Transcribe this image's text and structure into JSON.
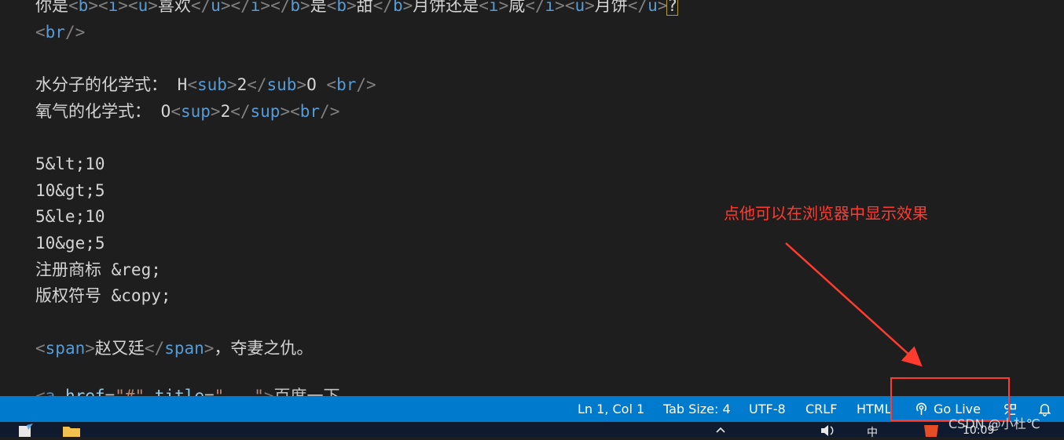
{
  "editor": {
    "line1": {
      "t1": "你是",
      "t2": "喜欢",
      "t3": "是",
      "t4": "甜",
      "t5": "月饼还是",
      "t6": "咸",
      "t7": "月饼",
      "t8": "?",
      "tag_b": "b",
      "tag_i": "i",
      "tag_u": "u"
    },
    "line2": {
      "tag": "br"
    },
    "line3": {
      "label": "水分子的化学式： ",
      "h": "H",
      "tag": "sub",
      "num": "2",
      "o": "O ",
      "br": "br"
    },
    "line4": {
      "label": "氧气的化学式： ",
      "o": "O",
      "tag": "sup",
      "num": "2",
      "br": "br"
    },
    "entities": [
      "5&lt;10",
      "10&gt;5",
      "5&le;10",
      "10&ge;5",
      "注册商标 &reg;",
      "版权符号 &copy;"
    ],
    "span_line": {
      "tag": "span",
      "text": "赵又廷",
      "tail": "，夺妻之仇。"
    },
    "partial_line": {
      "at1": "href",
      "s1": "\"#\"",
      "at2": "title",
      "s2": "\"...\"",
      "t": "百度一下"
    }
  },
  "annotation": {
    "text": "点他可以在浏览器中显示效果",
    "color": "#ff3b30"
  },
  "statusbar": {
    "position": "Ln 1, Col 1",
    "tab_size": "Tab Size: 4",
    "encoding": "UTF-8",
    "eol": "CRLF",
    "language": "HTML",
    "go_live": "Go Live",
    "background_color": "#007acc"
  },
  "taskbar": {
    "ime": "中",
    "clock": "10:09"
  },
  "watermark": "CSDN @小杜℃",
  "icons": [
    "broadcast-icon",
    "feedback-icon",
    "bell-icon",
    "notepad-icon",
    "folder-icon",
    "chevron-up-icon",
    "volume-icon",
    "html5-icon"
  ]
}
